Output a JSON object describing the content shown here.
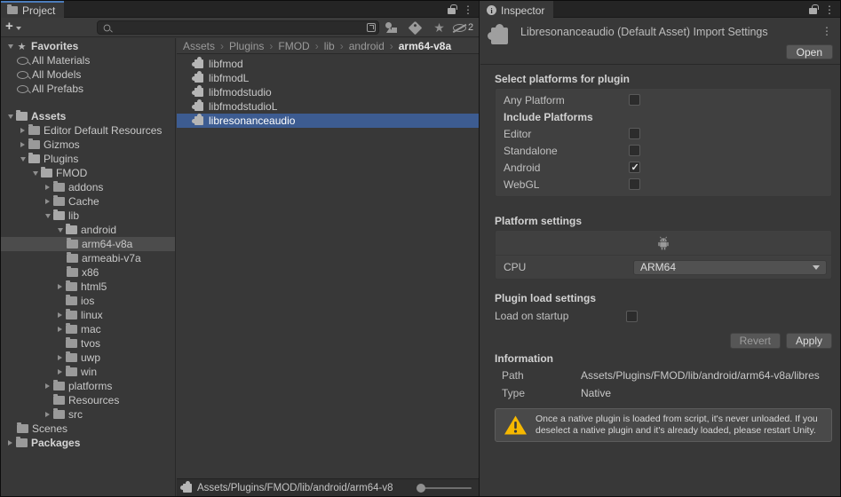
{
  "project": {
    "tab_label": "Project",
    "toolbar": {
      "create_button": "+",
      "search_value": "",
      "hidden_count": "2"
    },
    "favorites": {
      "label": "Favorites",
      "items": [
        {
          "label": "All Materials"
        },
        {
          "label": "All Models"
        },
        {
          "label": "All Prefabs"
        }
      ]
    },
    "tree": [
      {
        "label": "Assets"
      },
      {
        "label": "Editor Default Resources"
      },
      {
        "label": "Gizmos"
      },
      {
        "label": "Plugins"
      },
      {
        "label": "FMOD"
      },
      {
        "label": "addons"
      },
      {
        "label": "Cache"
      },
      {
        "label": "lib"
      },
      {
        "label": "android"
      },
      {
        "label": "arm64-v8a",
        "selected": true
      },
      {
        "label": "armeabi-v7a"
      },
      {
        "label": "x86"
      },
      {
        "label": "html5"
      },
      {
        "label": "ios"
      },
      {
        "label": "linux"
      },
      {
        "label": "mac"
      },
      {
        "label": "tvos"
      },
      {
        "label": "uwp"
      },
      {
        "label": "win"
      },
      {
        "label": "platforms"
      },
      {
        "label": "Resources"
      },
      {
        "label": "src"
      },
      {
        "label": "Scenes"
      },
      {
        "label": "Packages"
      }
    ],
    "breadcrumbs": [
      "Assets",
      "Plugins",
      "FMOD",
      "lib",
      "android",
      "arm64-v8a"
    ],
    "files": [
      {
        "name": "libfmod"
      },
      {
        "name": "libfmodL"
      },
      {
        "name": "libfmodstudio"
      },
      {
        "name": "libfmodstudioL"
      },
      {
        "name": "libresonanceaudio",
        "selected": true
      }
    ],
    "status": {
      "path": "Assets/Plugins/FMOD/lib/android/arm64-v8"
    }
  },
  "inspector": {
    "tab_label": "Inspector",
    "title": "Libresonanceaudio (Default Asset) Import Settings",
    "open_button": "Open",
    "platform_section": {
      "heading": "Select platforms for plugin",
      "rows": [
        {
          "label": "Any Platform",
          "checked": false
        },
        {
          "label": "Include Platforms",
          "header": true
        },
        {
          "label": "Editor",
          "checked": false
        },
        {
          "label": "Standalone",
          "checked": false
        },
        {
          "label": "Android",
          "checked": true
        },
        {
          "label": "WebGL",
          "checked": false
        }
      ]
    },
    "platform_settings": {
      "heading": "Platform settings",
      "cpu_label": "CPU",
      "cpu_value": "ARM64"
    },
    "plugin_load": {
      "heading": "Plugin load settings",
      "load_label": "Load on startup",
      "checked": false
    },
    "buttons": {
      "revert": "Revert",
      "apply": "Apply"
    },
    "information": {
      "heading": "Information",
      "path_label": "Path",
      "path_value": "Assets/Plugins/FMOD/lib/android/arm64-v8a/libres",
      "type_label": "Type",
      "type_value": "Native"
    },
    "warning": "Once a native plugin is loaded from script, it's never unloaded. If you deselect a native plugin and it's already loaded, please restart Unity."
  },
  "colors": {
    "selection_blue": "#3d5c91",
    "tree_selection": "#4c4c4c",
    "tab_accent": "#4c7dbb",
    "warning_yellow": "#f6b800"
  }
}
